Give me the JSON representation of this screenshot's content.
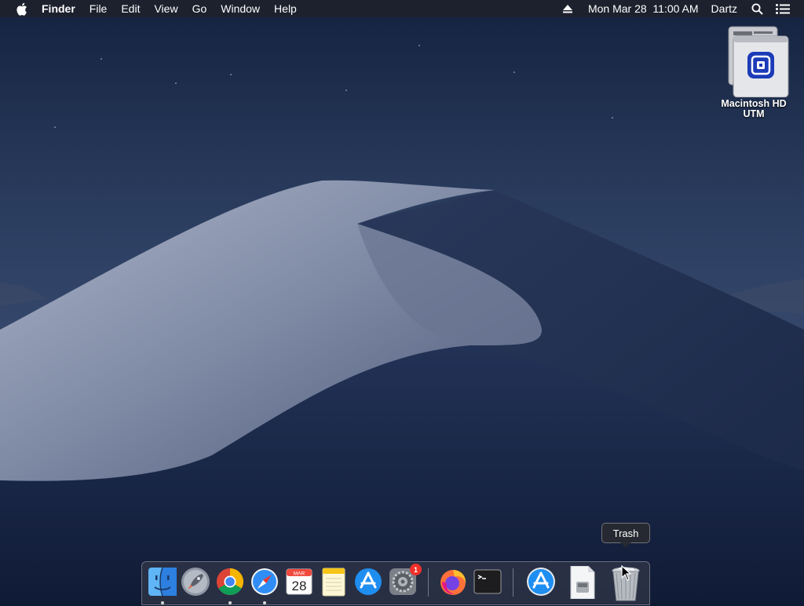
{
  "menubar": {
    "app_name": "Finder",
    "menus": [
      "File",
      "Edit",
      "View",
      "Go",
      "Window",
      "Help"
    ],
    "clock": "Mon Mar 28  11:00 AM",
    "user": "Dartz",
    "icons": [
      "apple-icon",
      "eject-icon",
      "spotlight-search-icon",
      "control-center-list-icon"
    ]
  },
  "desktop": {
    "disk_icon": {
      "label_line1": "Macintosh HD",
      "label_line2": "UTM"
    }
  },
  "tooltip": {
    "text": "Trash"
  },
  "dock": {
    "items": [
      {
        "name": "Finder",
        "icon": "finder-icon",
        "running": true
      },
      {
        "name": "Launchpad",
        "icon": "launchpad-icon",
        "running": false
      },
      {
        "name": "Google Chrome",
        "icon": "chrome-icon",
        "running": true
      },
      {
        "name": "Safari",
        "icon": "safari-icon",
        "running": true
      },
      {
        "name": "Calendar",
        "icon": "calendar-icon",
        "running": false,
        "month": "MAR",
        "day": "28"
      },
      {
        "name": "Notes",
        "icon": "notes-icon",
        "running": false
      },
      {
        "name": "App Store",
        "icon": "app-store-icon",
        "running": false
      },
      {
        "name": "System Preferences",
        "icon": "system-preferences-icon",
        "running": false,
        "badge": "1"
      },
      {
        "name": "Firefox",
        "icon": "firefox-icon",
        "running": false
      },
      {
        "name": "Terminal",
        "icon": "terminal-icon",
        "running": false
      },
      {
        "name": "Applications",
        "icon": "app-store-folder-icon",
        "running": false
      },
      {
        "name": "Document",
        "icon": "document-icon",
        "running": false
      },
      {
        "name": "Trash",
        "icon": "trash-icon",
        "running": false
      }
    ]
  },
  "colors": {
    "sky_top": "#1a2a4a",
    "sky_mid": "#33476a",
    "dune_light": "#9aa6bf",
    "badge_red": "#f0302a"
  }
}
